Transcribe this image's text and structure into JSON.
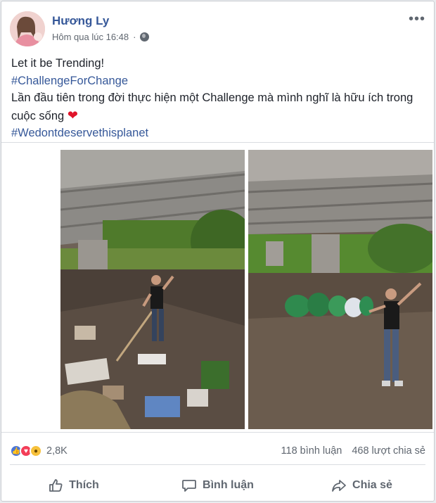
{
  "post": {
    "author": "Hương Ly",
    "timestamp": "Hôm qua lúc 16:48",
    "separator": "·",
    "more_icon": "more-horizontal-icon",
    "privacy_icon": "globe-icon",
    "lines": [
      "Let it be Trending!",
      "#ChallengeForChange",
      "Lần đầu tiên trong đời thực hiện một Challenge mà mình nghĩ là hữu ích trong cuộc sống",
      "#Wedontdeservethisplanet"
    ],
    "heart": "❤"
  },
  "stats": {
    "reaction_count": "2,8K",
    "reactions": [
      "like",
      "love",
      "wow"
    ],
    "comments": "118 bình luận",
    "shares": "468 lượt chia sẻ"
  },
  "actions": {
    "like": "Thích",
    "comment": "Bình luận",
    "share": "Chia sẻ"
  },
  "colors": {
    "link": "#365899",
    "heart": "#e0142a"
  }
}
